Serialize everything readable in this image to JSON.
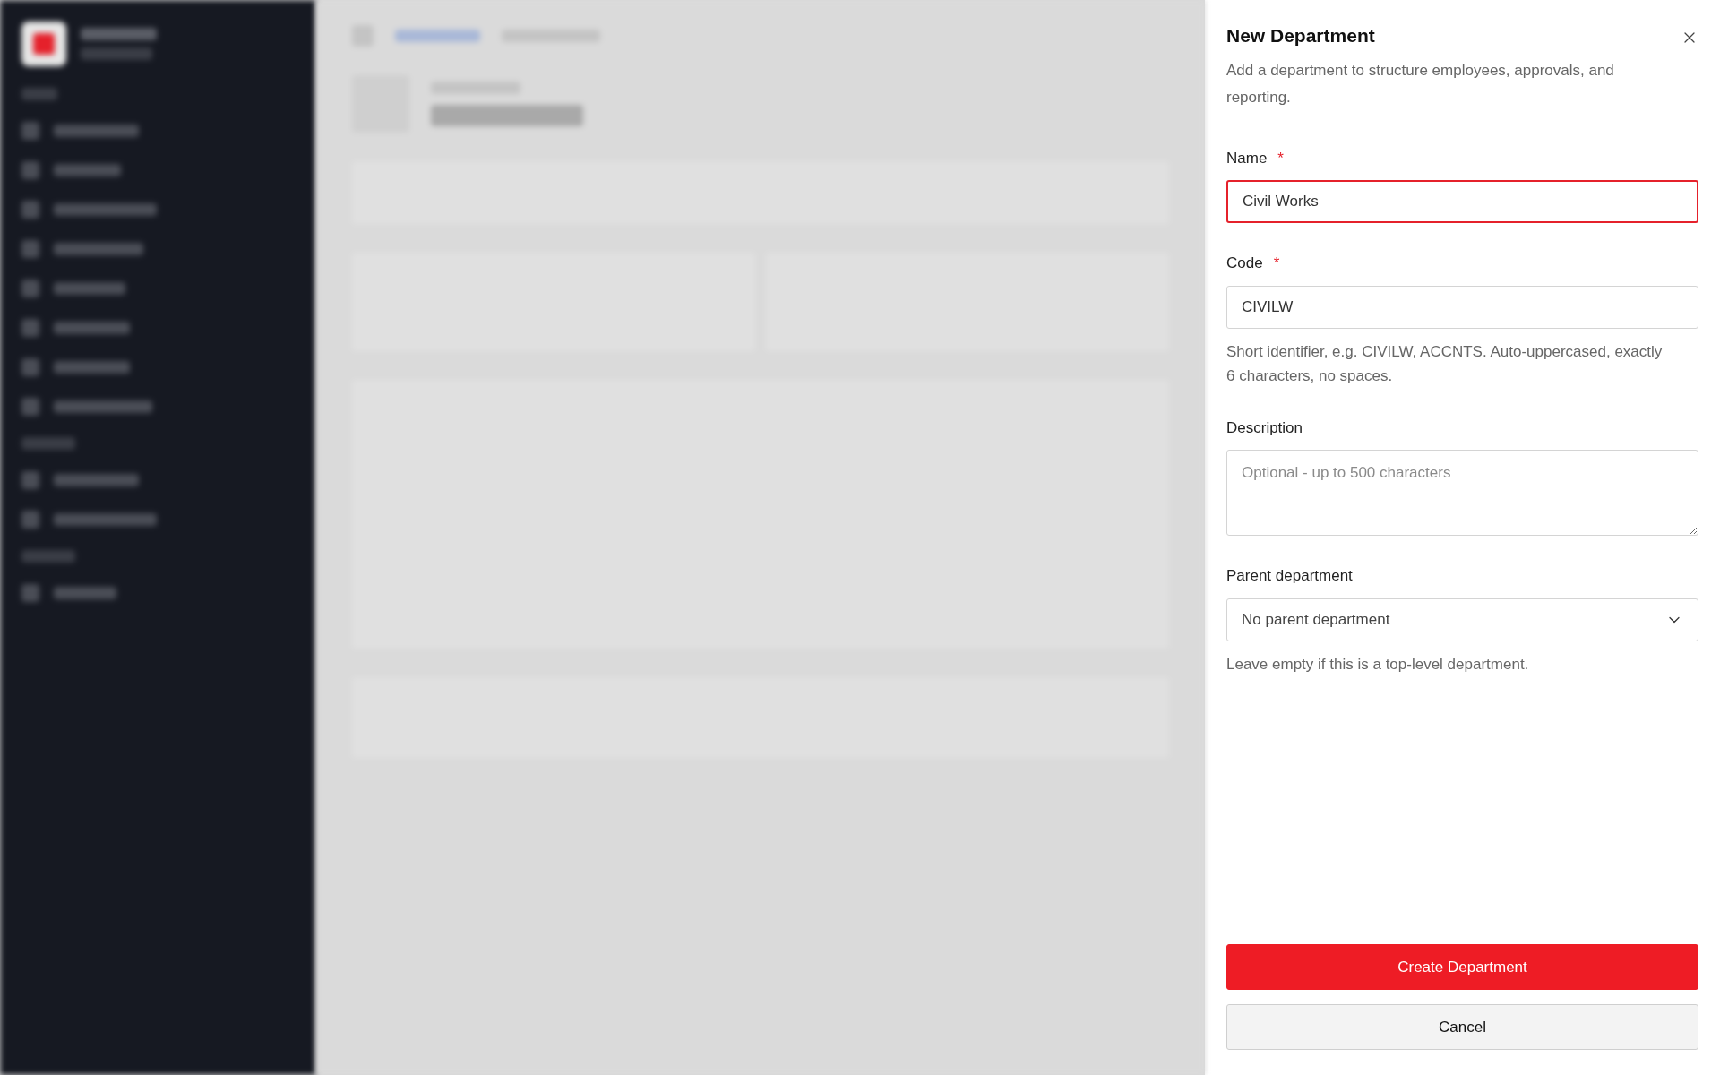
{
  "panel": {
    "title": "New Department",
    "subtitle": "Add a department to structure employees, approvals, and reporting.",
    "required_mark": "*",
    "fields": [
      {
        "kind": "input",
        "label": "Name",
        "required": true,
        "focused": true,
        "value": "Civil Works"
      },
      {
        "kind": "input",
        "label": "Code",
        "required": true,
        "focused": false,
        "value": "CIVILW",
        "help": "Short identifier, e.g. CIVILW, ACCNTS. Auto-uppercased, exactly 6 characters, no spaces."
      },
      {
        "kind": "textarea",
        "label": "Description",
        "required": false,
        "focused": false,
        "placeholder": "Optional - up to 500 characters"
      },
      {
        "kind": "select",
        "label": "Parent department",
        "required": false,
        "focused": false,
        "value": "No parent department",
        "help": "Leave empty if this is a top-level department."
      }
    ],
    "buttons": [
      {
        "kind": "primary",
        "label": "Create Department"
      },
      {
        "kind": "secondary",
        "label": "Cancel"
      }
    ]
  }
}
